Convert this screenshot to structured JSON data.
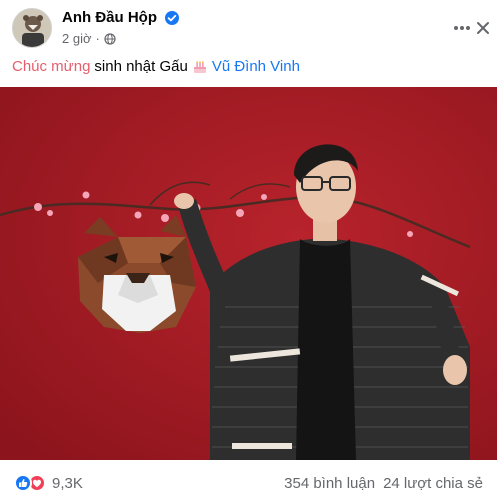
{
  "post": {
    "author": "Anh Đầu Hộp",
    "time": "2 giờ",
    "separator": "·",
    "caption_link": "Chúc mừng",
    "caption_text": "sinh nhật Gấu",
    "caption_tag": "Vũ Đình Vinh",
    "reaction_count": "9,3K",
    "comments": "354 bình luận",
    "shares": "24 lượt chia sẻ"
  },
  "colors": {
    "background": "#ffffff",
    "text_primary": "#050505",
    "text_secondary": "#65676b",
    "caption_highlight": "#e4606d",
    "tag_link": "#1877f2",
    "verified_badge": "#1877f2",
    "like_reaction": "#1877f2",
    "love_reaction": "#f33e58",
    "photo_background": "#a41c24"
  },
  "icons": {
    "verified": "verified-check-icon",
    "privacy": "globe-icon",
    "more": "more-horizontal-icon",
    "close": "close-icon",
    "cake": "birthday-cake-icon",
    "like": "like-reaction-icon",
    "love": "love-reaction-icon"
  }
}
